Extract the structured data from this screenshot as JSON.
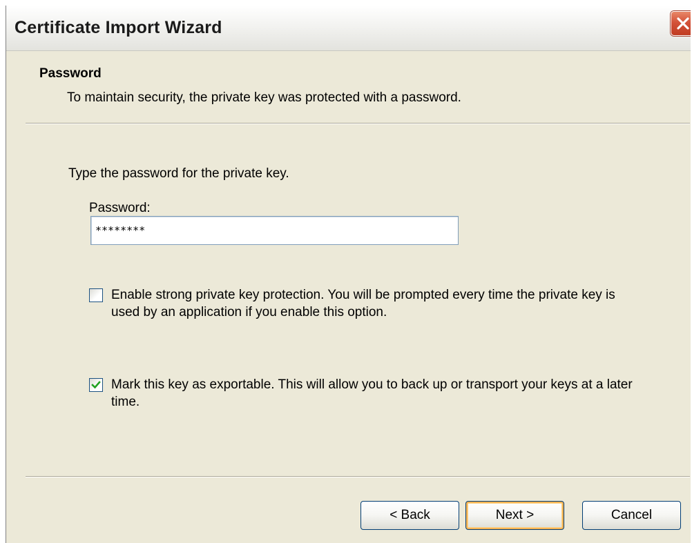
{
  "window": {
    "title": "Certificate Import Wizard"
  },
  "header": {
    "title": "Password",
    "subtitle": "To maintain security, the private key was protected with a password."
  },
  "body": {
    "instruction": "Type the password for the private key.",
    "password_label": "Password:",
    "password_value": "********",
    "strong_protection": {
      "checked": false,
      "label": "Enable strong private key protection. You will be prompted every time the private key is used by an application if you enable this option."
    },
    "exportable": {
      "checked": true,
      "label": "Mark this key as exportable. This will allow you to back up or transport your keys at a later time."
    }
  },
  "buttons": {
    "back": "< Back",
    "next": "Next >",
    "cancel": "Cancel"
  },
  "colors": {
    "dialog_bg": "#ece9d8",
    "close_button": "#d4533a",
    "checkmark": "#21a121",
    "default_button_focus": "#f8b352"
  },
  "icons": {
    "close": "close-icon",
    "check": "checkmark-icon"
  }
}
